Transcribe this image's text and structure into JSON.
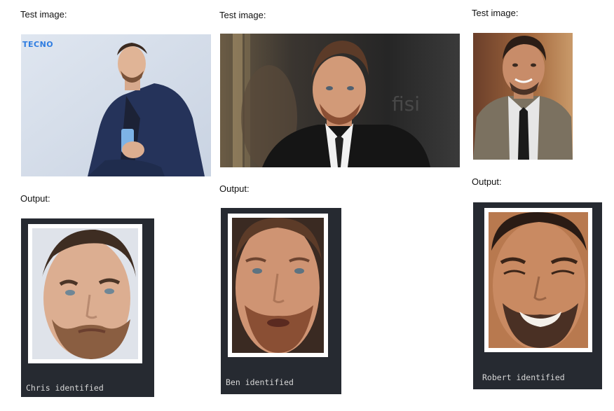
{
  "examples": [
    {
      "test_label": "Test image:",
      "output_label": "Output:",
      "brand": "TECNO",
      "identified": "Chris identified"
    },
    {
      "test_label": "Test image:",
      "output_label": "Output:",
      "identified": "Ben identified"
    },
    {
      "test_label": "Test image:",
      "output_label": "Output:",
      "identified": "Robert identified"
    }
  ],
  "colors": {
    "panel": "#262a31",
    "frame": "#ffffff",
    "brand": "#2f7de1"
  }
}
